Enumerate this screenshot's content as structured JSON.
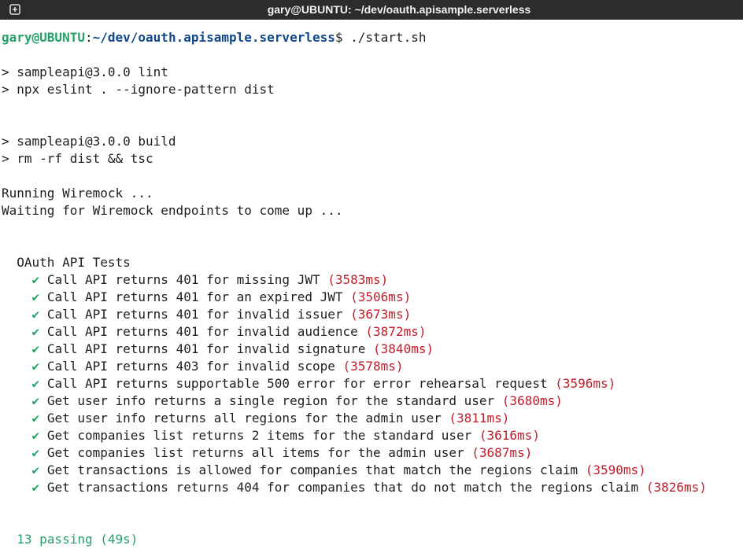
{
  "window": {
    "title": "gary@UBUNTU: ~/dev/oauth.apisample.serverless"
  },
  "prompt": {
    "user_host": "gary@UBUNTU",
    "separator": ":",
    "path": "~/dev/oauth.apisample.serverless",
    "symbol": "$",
    "command": " ./start.sh"
  },
  "output": {
    "lint_1": "> sampleapi@3.0.0 lint",
    "lint_2": "> npx eslint . --ignore-pattern dist",
    "build_1": "> sampleapi@3.0.0 build",
    "build_2": "> rm -rf dist && tsc",
    "running": "Running Wiremock ...",
    "waiting": "Waiting for Wiremock endpoints to come up ...",
    "suite_title": "OAuth API Tests"
  },
  "tests": [
    {
      "check": "✔",
      "name": "Call API returns 401 for missing JWT",
      "time": "(3583ms)"
    },
    {
      "check": "✔",
      "name": "Call API returns 401 for an expired JWT",
      "time": "(3506ms)"
    },
    {
      "check": "✔",
      "name": "Call API returns 401 for invalid issuer",
      "time": "(3673ms)"
    },
    {
      "check": "✔",
      "name": "Call API returns 401 for invalid audience",
      "time": "(3872ms)"
    },
    {
      "check": "✔",
      "name": "Call API returns 401 for invalid signature",
      "time": "(3840ms)"
    },
    {
      "check": "✔",
      "name": "Call API returns 403 for invalid scope",
      "time": "(3578ms)"
    },
    {
      "check": "✔",
      "name": "Call API returns supportable 500 error for error rehearsal request",
      "time": "(3596ms)"
    },
    {
      "check": "✔",
      "name": "Get user info returns a single region for the standard user",
      "time": "(3680ms)"
    },
    {
      "check": "✔",
      "name": "Get user info returns all regions for the admin user",
      "time": "(3811ms)"
    },
    {
      "check": "✔",
      "name": "Get companies list returns 2 items for the standard user",
      "time": "(3616ms)"
    },
    {
      "check": "✔",
      "name": "Get companies list returns all items for the admin user",
      "time": "(3687ms)"
    },
    {
      "check": "✔",
      "name": "Get transactions is allowed for companies that match the regions claim",
      "time": "(3590ms)"
    },
    {
      "check": "✔",
      "name": "Get transactions returns 404 for companies that do not match the regions claim",
      "time": "(3826ms)"
    }
  ],
  "summary": {
    "passing": "13 passing",
    "duration": "(49s)"
  },
  "colors": {
    "titlebar": "#2c2c2c",
    "background": "#ffffff",
    "prompt_user": "#26a269",
    "prompt_path": "#12488b",
    "pass": "#26a269",
    "time": "#c01c28"
  }
}
